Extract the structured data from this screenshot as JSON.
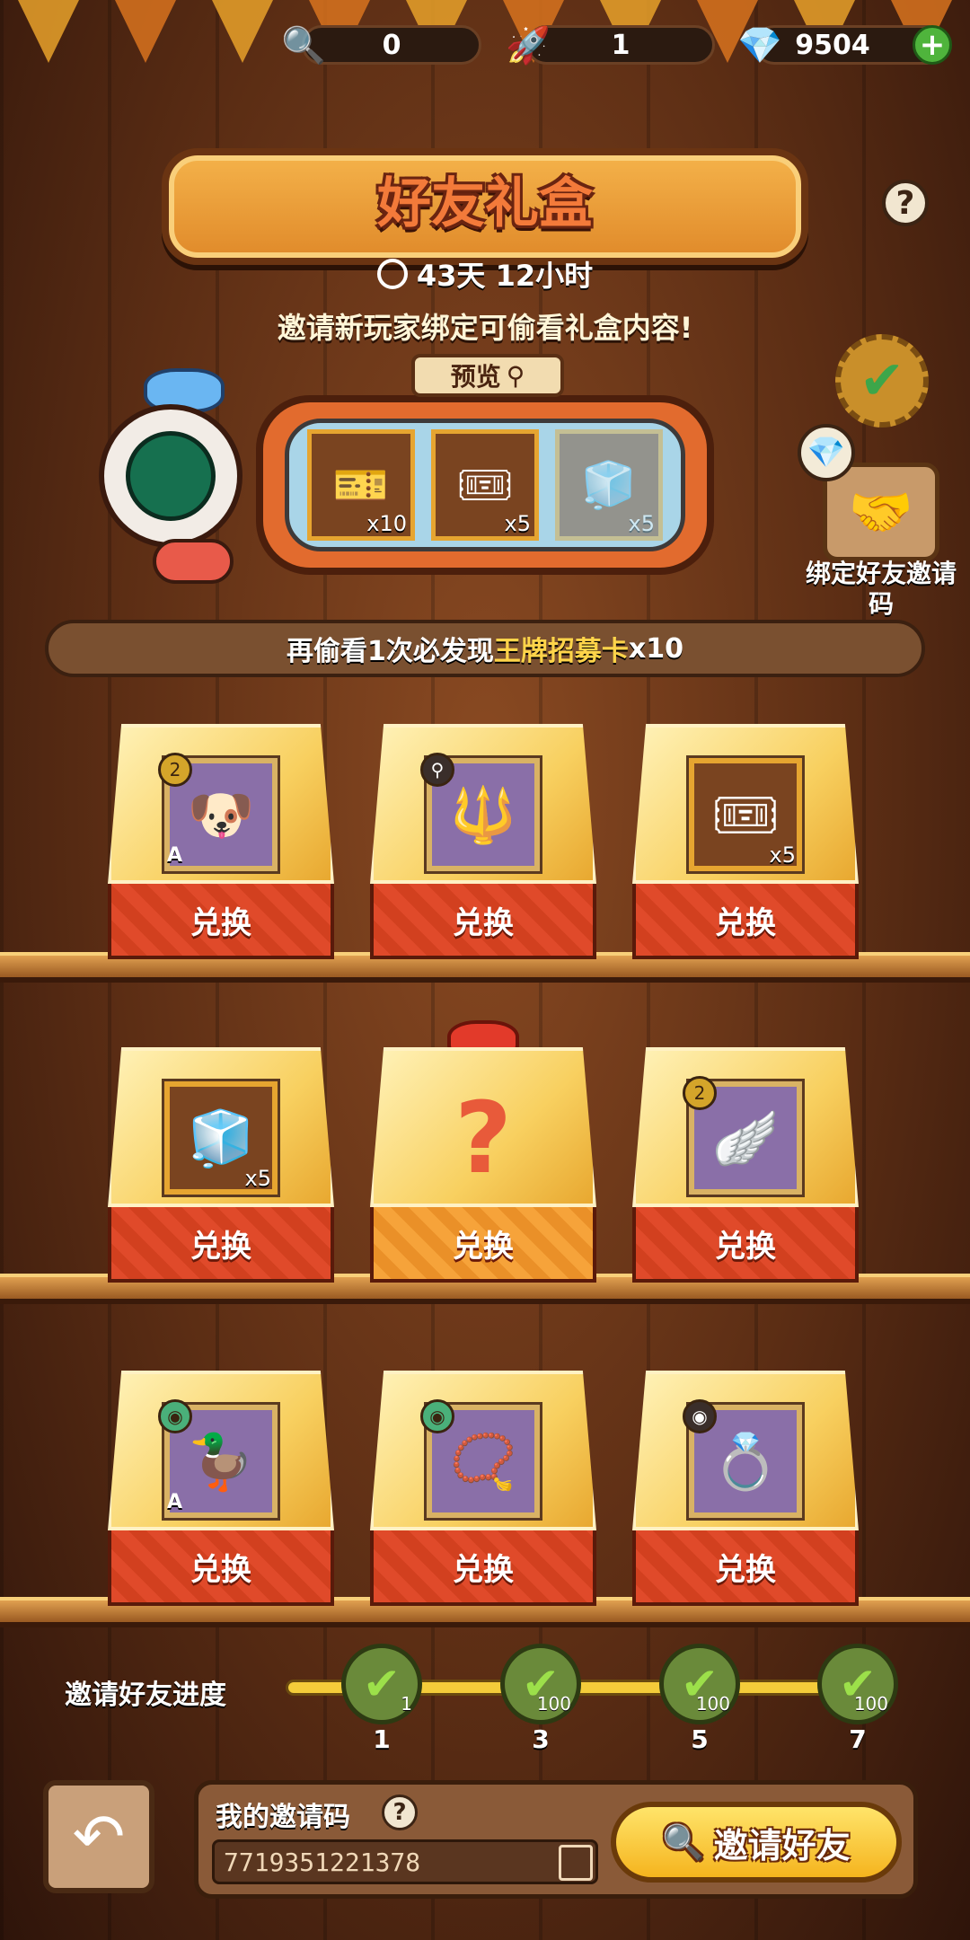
{
  "currency": {
    "magnifier": {
      "icon": "magnifier-icon",
      "value": "0"
    },
    "rocket": {
      "icon": "rocket-icon",
      "value": "1"
    },
    "diamond": {
      "icon": "diamond-icon",
      "value": "9504"
    }
  },
  "header": {
    "title": "好友礼盒",
    "timer": "43天 12小时",
    "hint": "邀请新玩家绑定可偷看礼盒内容!"
  },
  "preview": {
    "label": "预览",
    "items": [
      {
        "icon": "gold-ticket-icon",
        "count": "x10"
      },
      {
        "icon": "blue-ticket-icon",
        "count": "x5"
      },
      {
        "icon": "cube-icon",
        "count": "x5"
      }
    ]
  },
  "side": {
    "bind_label": "绑定好友邀请码"
  },
  "banner": {
    "prefix": "再偷看1次必发现",
    "highlight": "王牌招募卡",
    "suffix": " x10"
  },
  "shelves": [
    [
      {
        "icon": "dog-card-icon",
        "grade": "A",
        "badge": "2",
        "button": "兑换"
      },
      {
        "icon": "scepter-icon",
        "badge": "⚲",
        "button": "兑换"
      },
      {
        "icon": "blue-ticket-icon",
        "qty": "x5",
        "button": "兑换"
      }
    ],
    [
      {
        "icon": "cube-icon",
        "qty": "x5",
        "button": "兑换"
      },
      {
        "icon": "mystery-icon",
        "mystery": "?",
        "button": "兑换"
      },
      {
        "icon": "wing-charm-icon",
        "badge": "2",
        "button": "兑换"
      }
    ],
    [
      {
        "icon": "duck-card-icon",
        "grade": "A",
        "badge": "◉",
        "button": "兑换"
      },
      {
        "icon": "bracelet-icon",
        "badge": "◉",
        "button": "兑换"
      },
      {
        "icon": "ring-icon",
        "badge": "◉",
        "button": "兑换"
      }
    ]
  ],
  "progress": {
    "label": "邀请好友进度",
    "milestones": [
      {
        "num": "1",
        "reward": "1"
      },
      {
        "num": "3",
        "reward": "100"
      },
      {
        "num": "5",
        "reward": "100"
      },
      {
        "num": "7",
        "reward": "100"
      }
    ]
  },
  "bottom": {
    "code_title": "我的邀请码",
    "code_value": "7719351221378",
    "invite_button": "邀请好友"
  }
}
